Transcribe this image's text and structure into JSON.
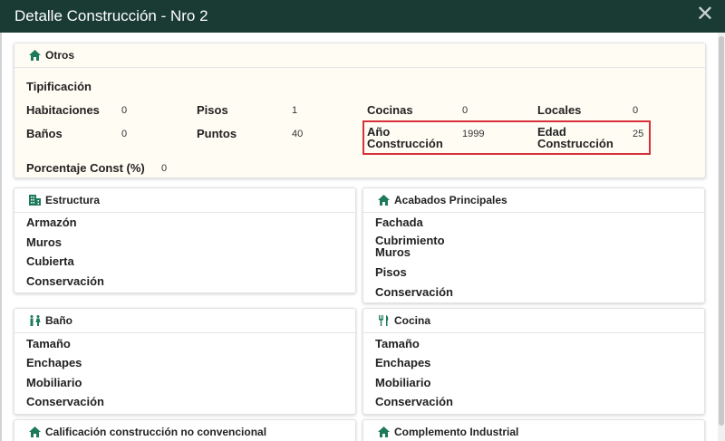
{
  "window": {
    "title": "Detalle Construcción - Nro 2",
    "close": "✕"
  },
  "otros": {
    "title": "Otros",
    "tipificacion": "Tipificación",
    "habitaciones": {
      "label": "Habitaciones",
      "value": "0"
    },
    "pisos": {
      "label": "Pisos",
      "value": "1"
    },
    "cocinas": {
      "label": "Cocinas",
      "value": "0"
    },
    "locales": {
      "label": "Locales",
      "value": "0"
    },
    "banos": {
      "label": "Baños",
      "value": "0"
    },
    "puntos": {
      "label": "Puntos",
      "value": "40"
    },
    "anio_construccion": {
      "label_line1": "Año",
      "label_line2": "Construcción",
      "value": "1999"
    },
    "edad_construccion": {
      "label_line1": "Edad",
      "label_line2": "Construcción",
      "value": "25"
    },
    "porcentaje": {
      "label": "Porcentaje Const (%)",
      "value": "0"
    }
  },
  "estructura": {
    "title": "Estructura",
    "items": [
      "Armazón",
      "Muros",
      "Cubierta",
      "Conservación"
    ]
  },
  "acabados": {
    "title": "Acabados Principales",
    "items": [
      "Fachada",
      "Cubrimiento",
      "Muros",
      "Pisos",
      "Conservación"
    ]
  },
  "bano": {
    "title": "Baño",
    "items": [
      "Tamaño",
      "Enchapes",
      "Mobiliario",
      "Conservación"
    ]
  },
  "cocina": {
    "title": "Cocina",
    "items": [
      "Tamaño",
      "Enchapes",
      "Mobiliario",
      "Conservación"
    ]
  },
  "calificacion": {
    "title": "Calificación construcción no convencional"
  },
  "complemento": {
    "title": "Complemento Industrial"
  },
  "colors": {
    "header": "#1a3b34",
    "icon": "#1e7a5c",
    "highlight": "#d6303a"
  }
}
